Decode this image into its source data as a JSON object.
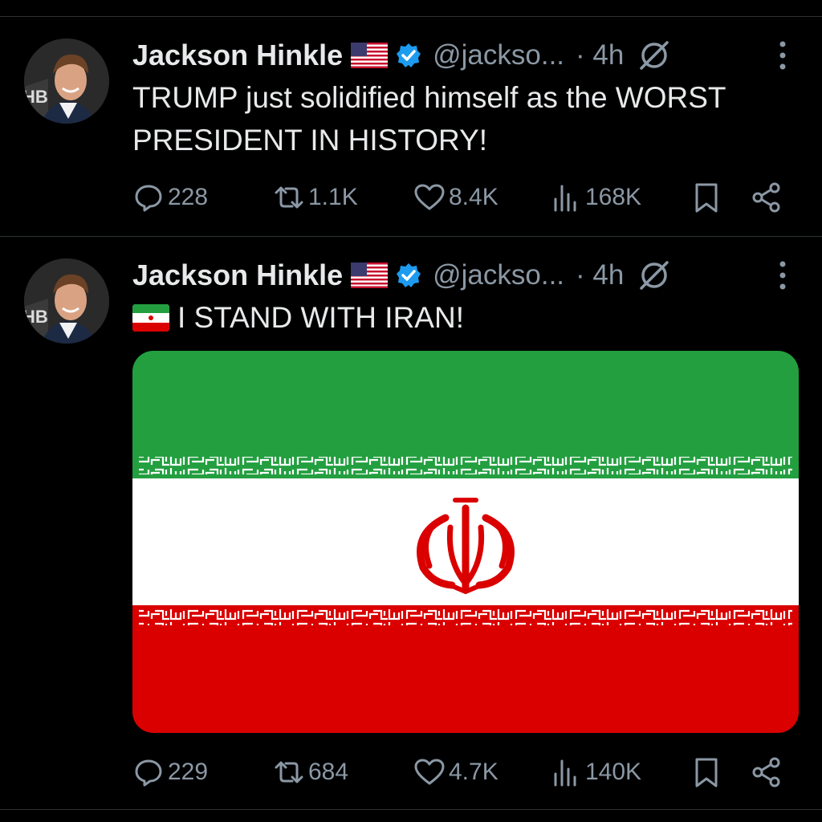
{
  "tweets": [
    {
      "author_name": "Jackson Hinkle",
      "handle": "@jackso...",
      "time": "· 4h",
      "text": "TRUMP just solidified himself as the WORST PRESIDENT IN HISTORY!",
      "text_emoji": "",
      "replies": "228",
      "reposts": "1.1K",
      "likes": "8.4K",
      "views": "168K",
      "avatar_text": "HB"
    },
    {
      "author_name": "Jackson Hinkle",
      "handle": "@jackso...",
      "time": "· 4h",
      "text": "I STAND WITH IRAN!",
      "text_emoji": "iran-flag-emoji",
      "replies": "229",
      "reposts": "684",
      "likes": "4.7K",
      "views": "140K",
      "avatar_text": "HB",
      "media": "iran-flag-image"
    }
  ],
  "colors": {
    "background": "#000000",
    "text": "#e7e9ea",
    "secondary": "#8b98a5",
    "verified": "#1d9bf0",
    "flag_green": "#239f40",
    "flag_white": "#ffffff",
    "flag_red": "#da0000"
  },
  "icons": [
    "reply-icon",
    "repost-icon",
    "like-icon",
    "views-icon",
    "bookmark-icon",
    "share-icon",
    "grok-icon",
    "more-icon",
    "verified-badge-icon",
    "us-flag-emoji"
  ]
}
